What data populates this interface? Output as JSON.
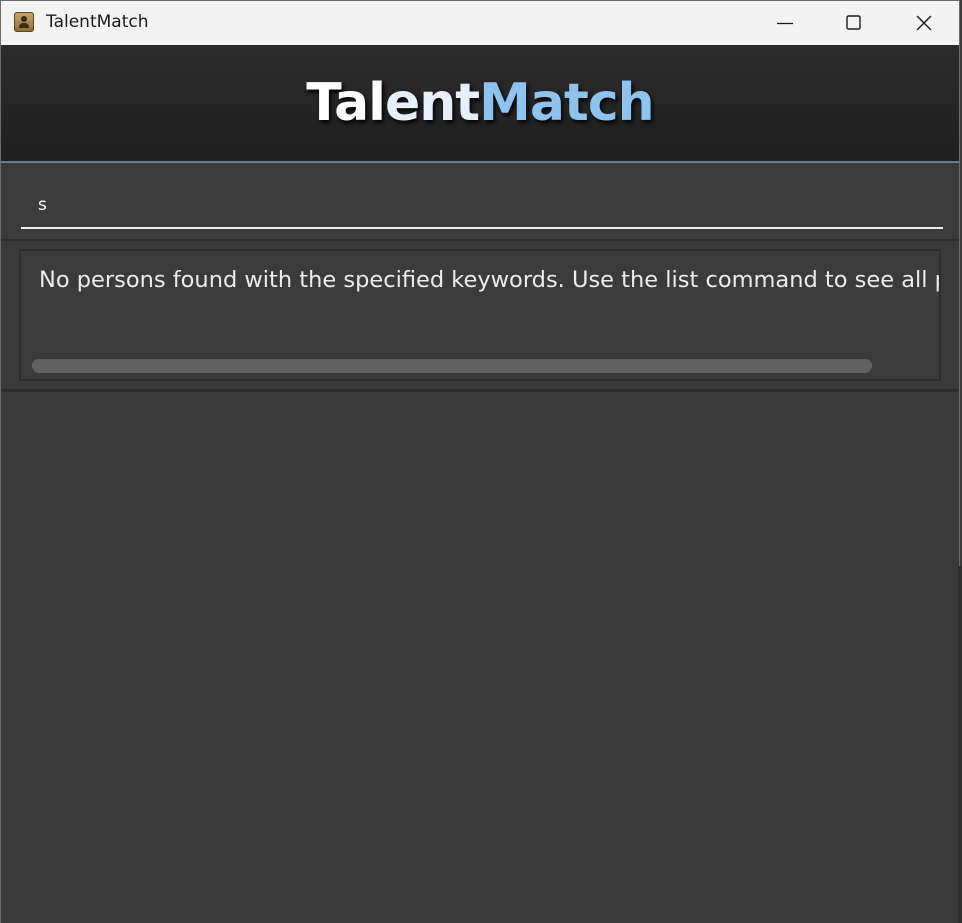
{
  "window": {
    "title": "TalentMatch",
    "app_icon": "address-book-icon",
    "controls": {
      "minimize_icon": "minimize-icon",
      "maximize_icon": "maximize-icon",
      "close_icon": "close-icon"
    }
  },
  "header": {
    "brand_part1": "Tal",
    "brand_part2": "ent",
    "brand_part3": "Match"
  },
  "command_box": {
    "value": "s"
  },
  "result_display": {
    "message": "No persons found with the specified keywords. Use the list command to see all persons."
  },
  "colors": {
    "background": "#3a3a3a",
    "header_background": "#252525",
    "accent_border": "#5f7d93",
    "brand_blue": "#8ec3f0"
  }
}
